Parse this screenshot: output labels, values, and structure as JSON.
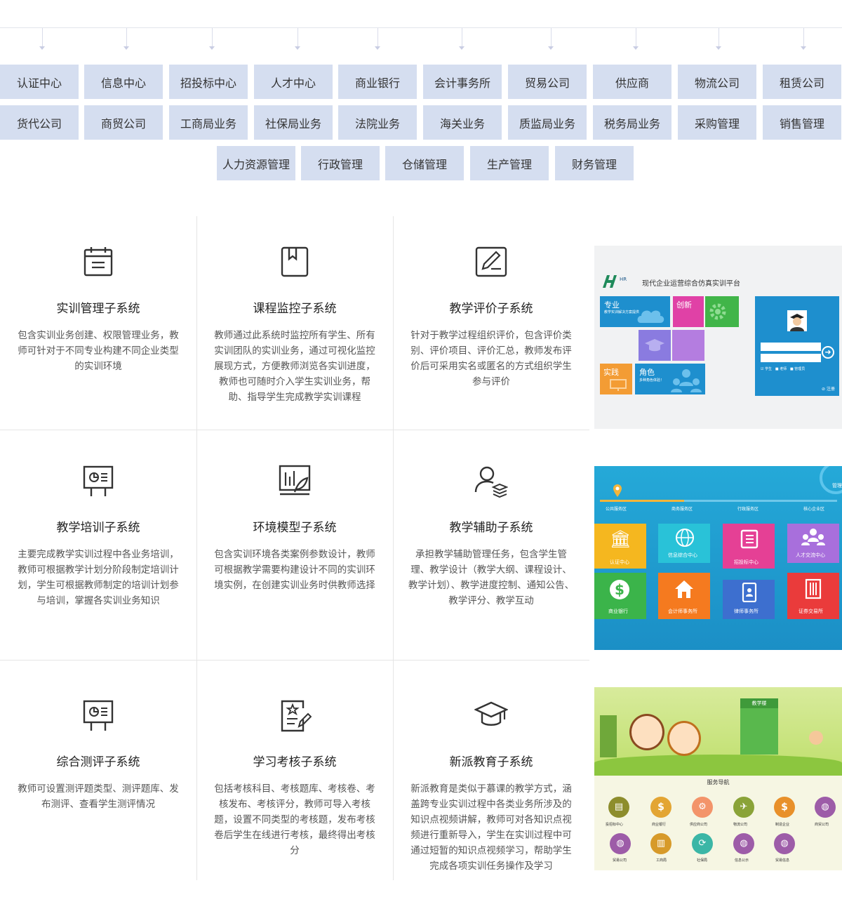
{
  "tags_row1": [
    "认证中心",
    "信息中心",
    "招投标中心",
    "人才中心",
    "商业银行",
    "会计事务所",
    "贸易公司",
    "供应商",
    "物流公司",
    "租赁公司"
  ],
  "tags_row2": [
    "货代公司",
    "商贸公司",
    "工商局业务",
    "社保局业务",
    "法院业务",
    "海关业务",
    "质监局业务",
    "税务局业务",
    "采购管理",
    "销售管理"
  ],
  "tags_row3": [
    "人力资源管理",
    "行政管理",
    "仓储管理",
    "生产管理",
    "财务管理"
  ],
  "subsystems": [
    {
      "icon": "calendar-icon",
      "title": "实训管理子系统",
      "desc": "包含实训业务创建、权限管理业务，教师可针对于不同专业构建不同企业类型的实训环境"
    },
    {
      "icon": "bookmark-book-icon",
      "title": "课程监控子系统",
      "desc": "教师通过此系统时监控所有学生、所有实训团队的实训业务，通过可视化监控展现方式，方便教师浏览各实训进度，教师也可随时介入学生实训业务，帮助、指导学生完成教学实训课程"
    },
    {
      "icon": "edit-icon",
      "title": "教学评价子系统",
      "desc": "针对于教学过程组织评价，包含评价类别、评价项目、评价汇总，教师发布评价后可采用实名或匿名的方式组织学生参与评价"
    },
    {
      "icon": "presentation-board-icon",
      "title": "教学培训子系统",
      "desc": "主要完成教学实训过程中各业务培训，教师可根据教学计划分阶段制定培训计划，学生可根据教师制定的培训计划参与培训，掌握各实训业务知识"
    },
    {
      "icon": "bar-chart-icon",
      "title": "环境模型子系统",
      "desc": "包含实训环境各类案例参数设计，教师可根据教学需要构建设计不同的实训环境实例，在创建实训业务时供教师选择"
    },
    {
      "icon": "user-stack-icon",
      "title": "教学辅助子系统",
      "desc": "承担教学辅助管理任务，包含学生管理、教学设计（教学大纲、课程设计、教学计划）、教学进度控制、通知公告、教学评分、教学互动"
    },
    {
      "icon": "presentation-board-icon",
      "title": "综合测评子系统",
      "desc": "教师可设置测评题类型、测评题库、发布测评、查看学生测评情况"
    },
    {
      "icon": "exam-paper-icon",
      "title": "学习考核子系统",
      "desc": "包括考核科目、考核题库、考核卷、考核发布、考核评分，教师可导入考核题，设置不同类型的考核题，发布考核卷后学生在线进行考核，最终得出考核分"
    },
    {
      "icon": "graduation-cap-icon",
      "title": "新派教育子系统",
      "desc": "新派教育是类似于慕课的教学方式，涵盖跨专业实训过程中各类业务所涉及的知识点视频讲解，教师可对各知识点视频进行重新导入，学生在实训过程中可通过短暂的知识点视频学习，帮助学生完成各项实训任务操作及学习"
    }
  ],
  "shot1": {
    "platform_title": "现代企业运营综合仿真实训平台",
    "tiles": [
      "专业",
      "创新",
      "实践",
      "角色"
    ],
    "tile_sub1": "教学实训解决方案提供",
    "tile_sub2": "多种角色体验！",
    "login_options": [
      "学生",
      "老师",
      "管理员"
    ],
    "register": "注册"
  },
  "shot2": {
    "zones": [
      "公共服务区",
      "商务服务区",
      "行政服务区",
      "核心企业区"
    ],
    "tiles": [
      "认证中心",
      "信息综合中心",
      "招投标中心",
      "人才交流中心",
      "商业银行",
      "会计师事务所",
      "律师事务所",
      "证券交易所"
    ],
    "corner": "管理"
  },
  "shot3": {
    "building_label": "教学楼",
    "nav_title": "服务导航",
    "nav_items": [
      "投招标中心",
      "商业银行",
      "供应商公司",
      "物流公司",
      "制造企业",
      "商贸公司",
      "贸易公司",
      "工商局",
      "社保局",
      "信息公示",
      "贸易信息"
    ]
  },
  "colors": {
    "tag_bg": "#d5def0",
    "line": "#e5e5e5"
  }
}
